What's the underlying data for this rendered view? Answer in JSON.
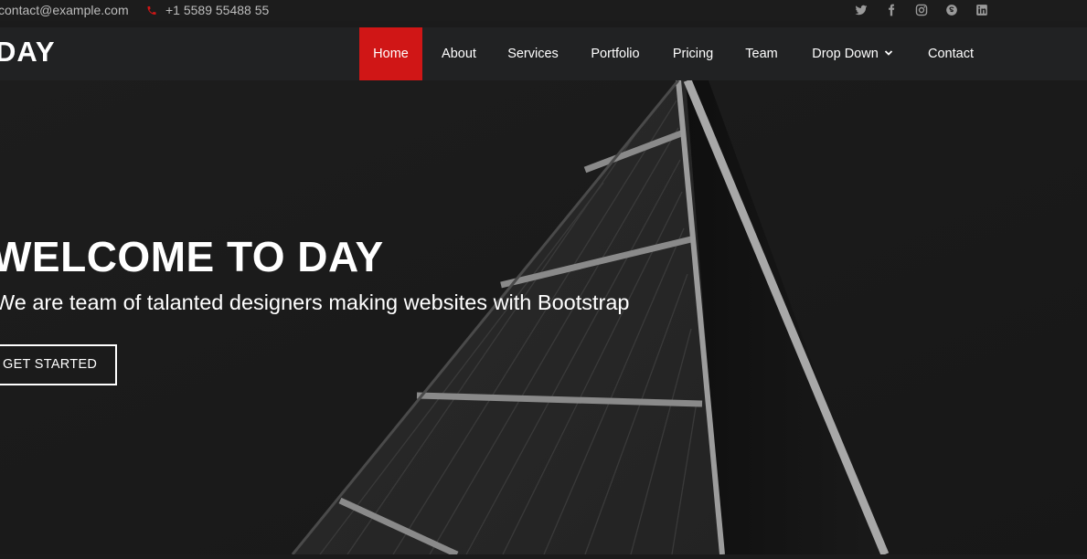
{
  "topbar": {
    "email": "contact@example.com",
    "phone": "+1 5589 55488 55",
    "social_icons": [
      "twitter-icon",
      "facebook-icon",
      "instagram-icon",
      "skype-icon",
      "linkedin-icon"
    ]
  },
  "header": {
    "logo": "DAY",
    "nav": [
      {
        "label": "Home",
        "active": true
      },
      {
        "label": "About"
      },
      {
        "label": "Services"
      },
      {
        "label": "Portfolio"
      },
      {
        "label": "Pricing"
      },
      {
        "label": "Team"
      },
      {
        "label": "Drop Down",
        "has_dropdown": true
      },
      {
        "label": "Contact"
      }
    ]
  },
  "hero": {
    "title": "WELCOME TO DAY",
    "subtitle": "We are team of talanted designers making websites with Bootstrap",
    "cta_label": "GET STARTED"
  },
  "colors": {
    "accent": "#d01616",
    "topbar_bg": "#1c1c1c",
    "header_bg": "#212223",
    "hero_bg": "#1b1b1b"
  }
}
